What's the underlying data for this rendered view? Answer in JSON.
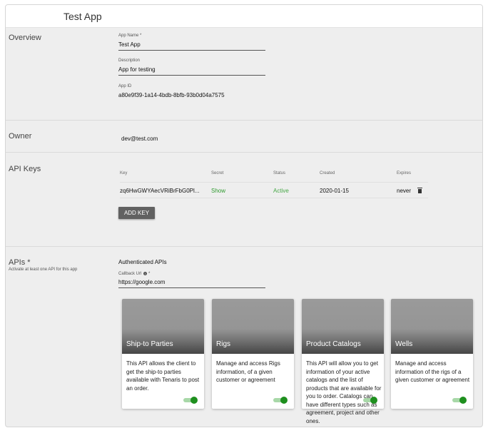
{
  "header": {
    "title": "Test App"
  },
  "overview": {
    "title": "Overview",
    "app_name_label": "App Name *",
    "app_name_value": "Test App",
    "description_label": "Description",
    "description_value": "App for testing",
    "app_id_label": "App ID",
    "app_id_value": "a80e9f39-1a14-4bdb-8bfb-93b0d04a7575"
  },
  "owner": {
    "title": "Owner",
    "value": "dev@test.com"
  },
  "api_keys": {
    "title": "API Keys",
    "columns": [
      "Key",
      "Secret",
      "Status",
      "Created",
      "Expires"
    ],
    "rows": [
      {
        "key": "zq6HwGWYAecVRiBrFbG0Pl...",
        "secret": "Show",
        "status": "Active",
        "created": "2020-01-15",
        "expires": "never"
      }
    ],
    "add_key_label": "ADD KEY"
  },
  "apis": {
    "title": "APIs *",
    "subtitle": "Activate at least one API for this app",
    "group_title": "Authenticated APIs",
    "callback_label": "Callback Url",
    "callback_required": "*",
    "callback_value": "https://google.com",
    "cards": [
      {
        "title": "Ship-to Parties",
        "description": "This API allows the client to get the ship-to parties available with Tenaris to post an order.",
        "enabled": true
      },
      {
        "title": "Rigs",
        "description": "Manage and access Rigs information, of a given customer or agreement",
        "enabled": true
      },
      {
        "title": "Product Catalogs",
        "description": "This API will allow you to get information of your active catalogs and the list of products that are available for you to order. Catalogs can have different types such as agreement, project and other ones.",
        "enabled": true
      },
      {
        "title": "Wells",
        "description": "Manage and access information of the rigs of a given customer or agreement",
        "enabled": true
      }
    ]
  },
  "colors": {
    "accent_green": "#1e8f1e",
    "button_bg": "#616161",
    "background": "#eeeeee"
  }
}
